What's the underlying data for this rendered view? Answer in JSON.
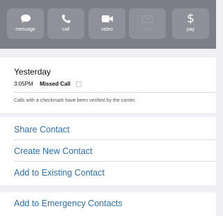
{
  "actions": [
    {
      "label": "message",
      "icon": "message-bubble-icon",
      "enabled": true
    },
    {
      "label": "call",
      "icon": "phone-icon",
      "enabled": true
    },
    {
      "label": "video",
      "icon": "video-camera-icon",
      "enabled": true
    },
    {
      "label": "mail",
      "icon": "envelope-icon",
      "enabled": false
    },
    {
      "label": "pay",
      "icon": "dollar-icon",
      "enabled": true
    }
  ],
  "call_history": {
    "day": "Yesterday",
    "time": "3:05PM",
    "type": "Missed Call",
    "note": "Calls with a checkmark have been verified by the carrier."
  },
  "contact_actions": {
    "share": "Share Contact",
    "create": "Create New Contact",
    "add_existing": "Add to Existing Contact"
  },
  "emergency": {
    "add": "Add to Emergency Contacts"
  },
  "colors": {
    "header_bg": "#7d7e87",
    "button_bg": "#8f9099",
    "link": "#2f6fae"
  }
}
